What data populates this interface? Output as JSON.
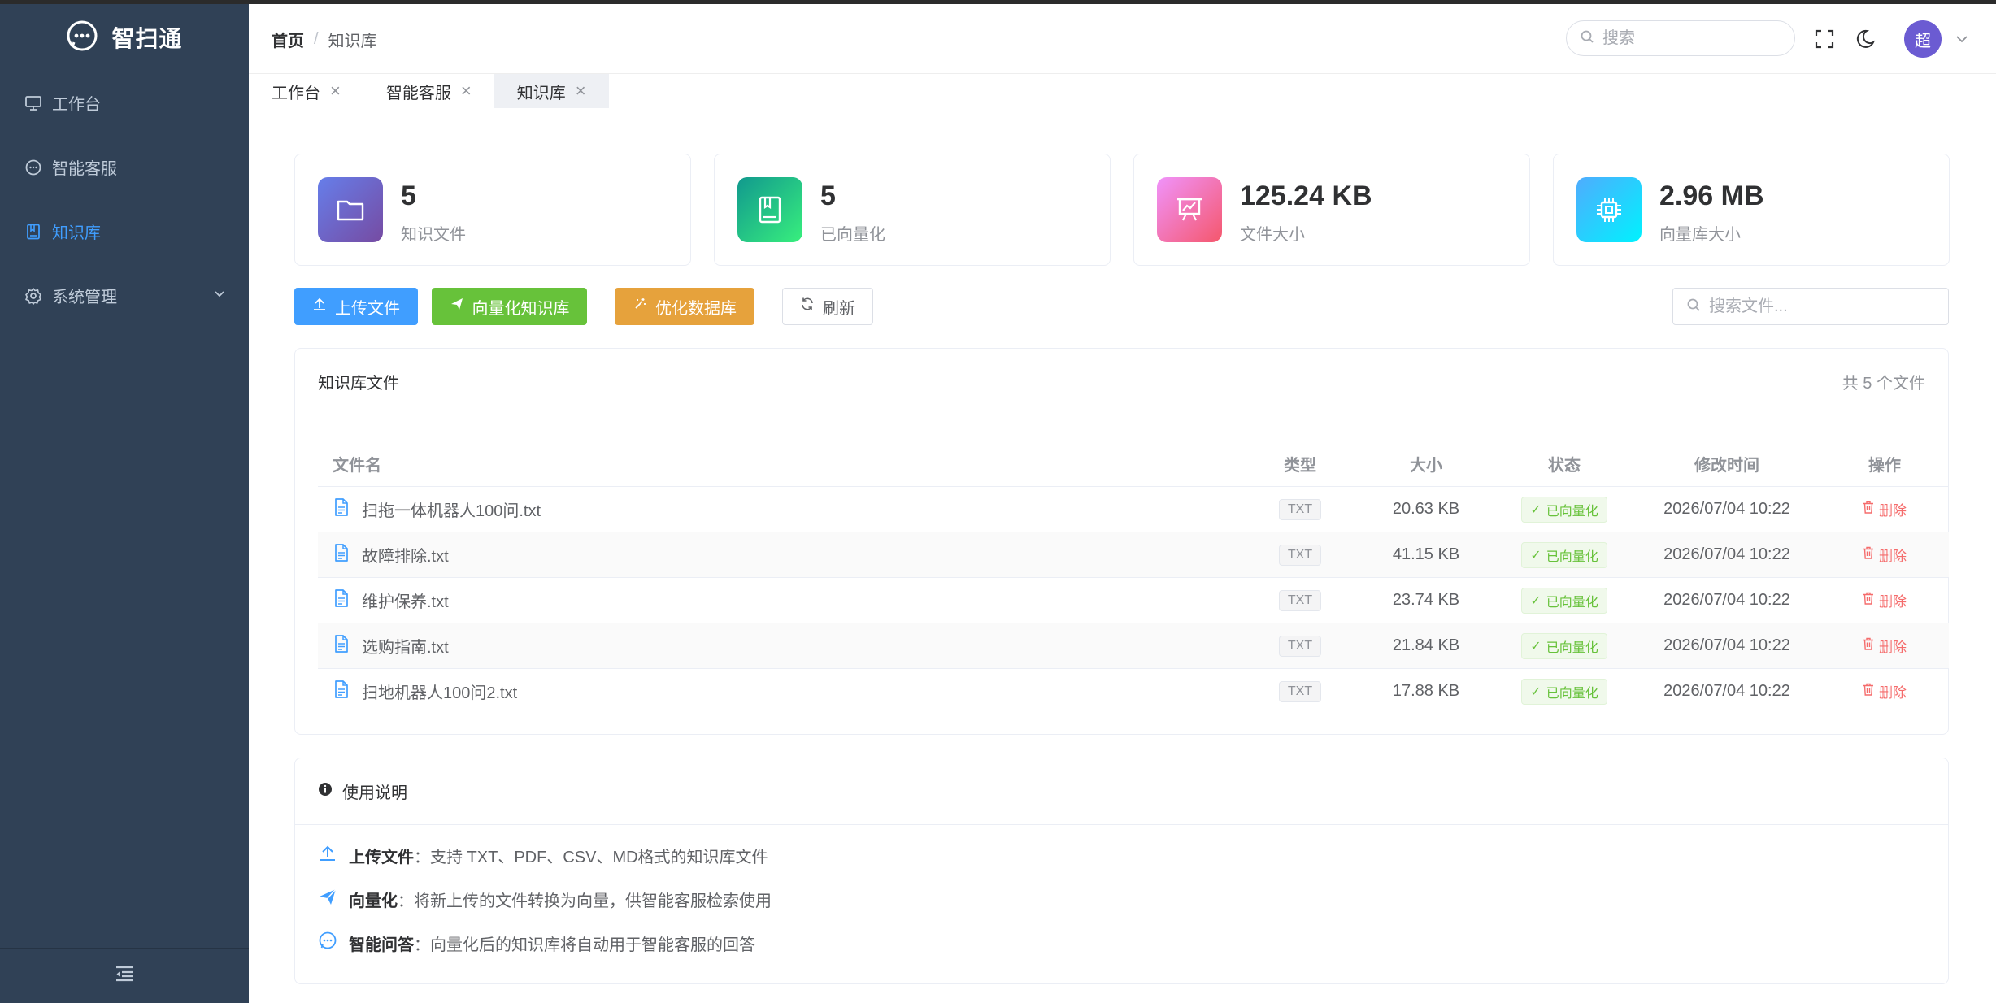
{
  "app": {
    "name": "智扫通"
  },
  "sidebar": {
    "items": [
      {
        "label": "工作台",
        "icon": "monitor-icon"
      },
      {
        "label": "智能客服",
        "icon": "chat-icon"
      },
      {
        "label": "知识库",
        "icon": "book-icon",
        "active": true
      },
      {
        "label": "系统管理",
        "icon": "gear-icon"
      }
    ]
  },
  "header": {
    "breadcrumb": {
      "home": "首页",
      "separator": "/",
      "current": "知识库"
    },
    "search_placeholder": "搜索",
    "avatar_text": "超"
  },
  "tabs": [
    {
      "label": "工作台"
    },
    {
      "label": "智能客服"
    },
    {
      "label": "知识库",
      "active": true
    }
  ],
  "stats": [
    {
      "value": "5",
      "label": "知识文件",
      "icon": "folder-icon"
    },
    {
      "value": "5",
      "label": "已向量化",
      "icon": "book-icon"
    },
    {
      "value": "125.24 KB",
      "label": "文件大小",
      "icon": "presentation-chart-icon"
    },
    {
      "value": "2.96 MB",
      "label": "向量库大小",
      "icon": "chip-icon"
    }
  ],
  "toolbar": {
    "upload": "上传文件",
    "vectorize": "向量化知识库",
    "optimize": "优化数据库",
    "refresh": "刷新",
    "search_placeholder": "搜索文件..."
  },
  "files_panel": {
    "title": "知识库文件",
    "count": "共 5 个文件",
    "columns": {
      "name": "文件名",
      "type": "类型",
      "size": "大小",
      "status": "状态",
      "time": "修改时间",
      "op": "操作"
    },
    "rows": [
      {
        "name": "扫拖一体机器人100问.txt",
        "type": "TXT",
        "size": "20.63 KB",
        "status": "已向量化",
        "time": "2026/07/04 10:22",
        "op": "删除"
      },
      {
        "name": "故障排除.txt",
        "type": "TXT",
        "size": "41.15 KB",
        "status": "已向量化",
        "time": "2026/07/04 10:22",
        "op": "删除"
      },
      {
        "name": "维护保养.txt",
        "type": "TXT",
        "size": "23.74 KB",
        "status": "已向量化",
        "time": "2026/07/04 10:22",
        "op": "删除"
      },
      {
        "name": "选购指南.txt",
        "type": "TXT",
        "size": "21.84 KB",
        "status": "已向量化",
        "time": "2026/07/04 10:22",
        "op": "删除"
      },
      {
        "name": "扫地机器人100问2.txt",
        "type": "TXT",
        "size": "17.88 KB",
        "status": "已向量化",
        "time": "2026/07/04 10:22",
        "op": "删除"
      }
    ]
  },
  "help_panel": {
    "title": "使用说明",
    "items": [
      {
        "term": "上传文件",
        "text": "：支持 TXT、PDF、CSV、MD格式的知识库文件",
        "icon": "upload-icon"
      },
      {
        "term": "向量化",
        "text": "：将新上传的文件转换为向量，供智能客服检索使用",
        "icon": "send-icon"
      },
      {
        "term": "智能问答",
        "text": "：向量化后的知识库将自动用于智能客服的回答",
        "icon": "chat-icon"
      }
    ]
  },
  "colors": {
    "sidebar_bg": "#304156",
    "primary": "#409eff",
    "success": "#67c23a",
    "warning": "#e6a23c",
    "danger": "#f56c6c"
  }
}
